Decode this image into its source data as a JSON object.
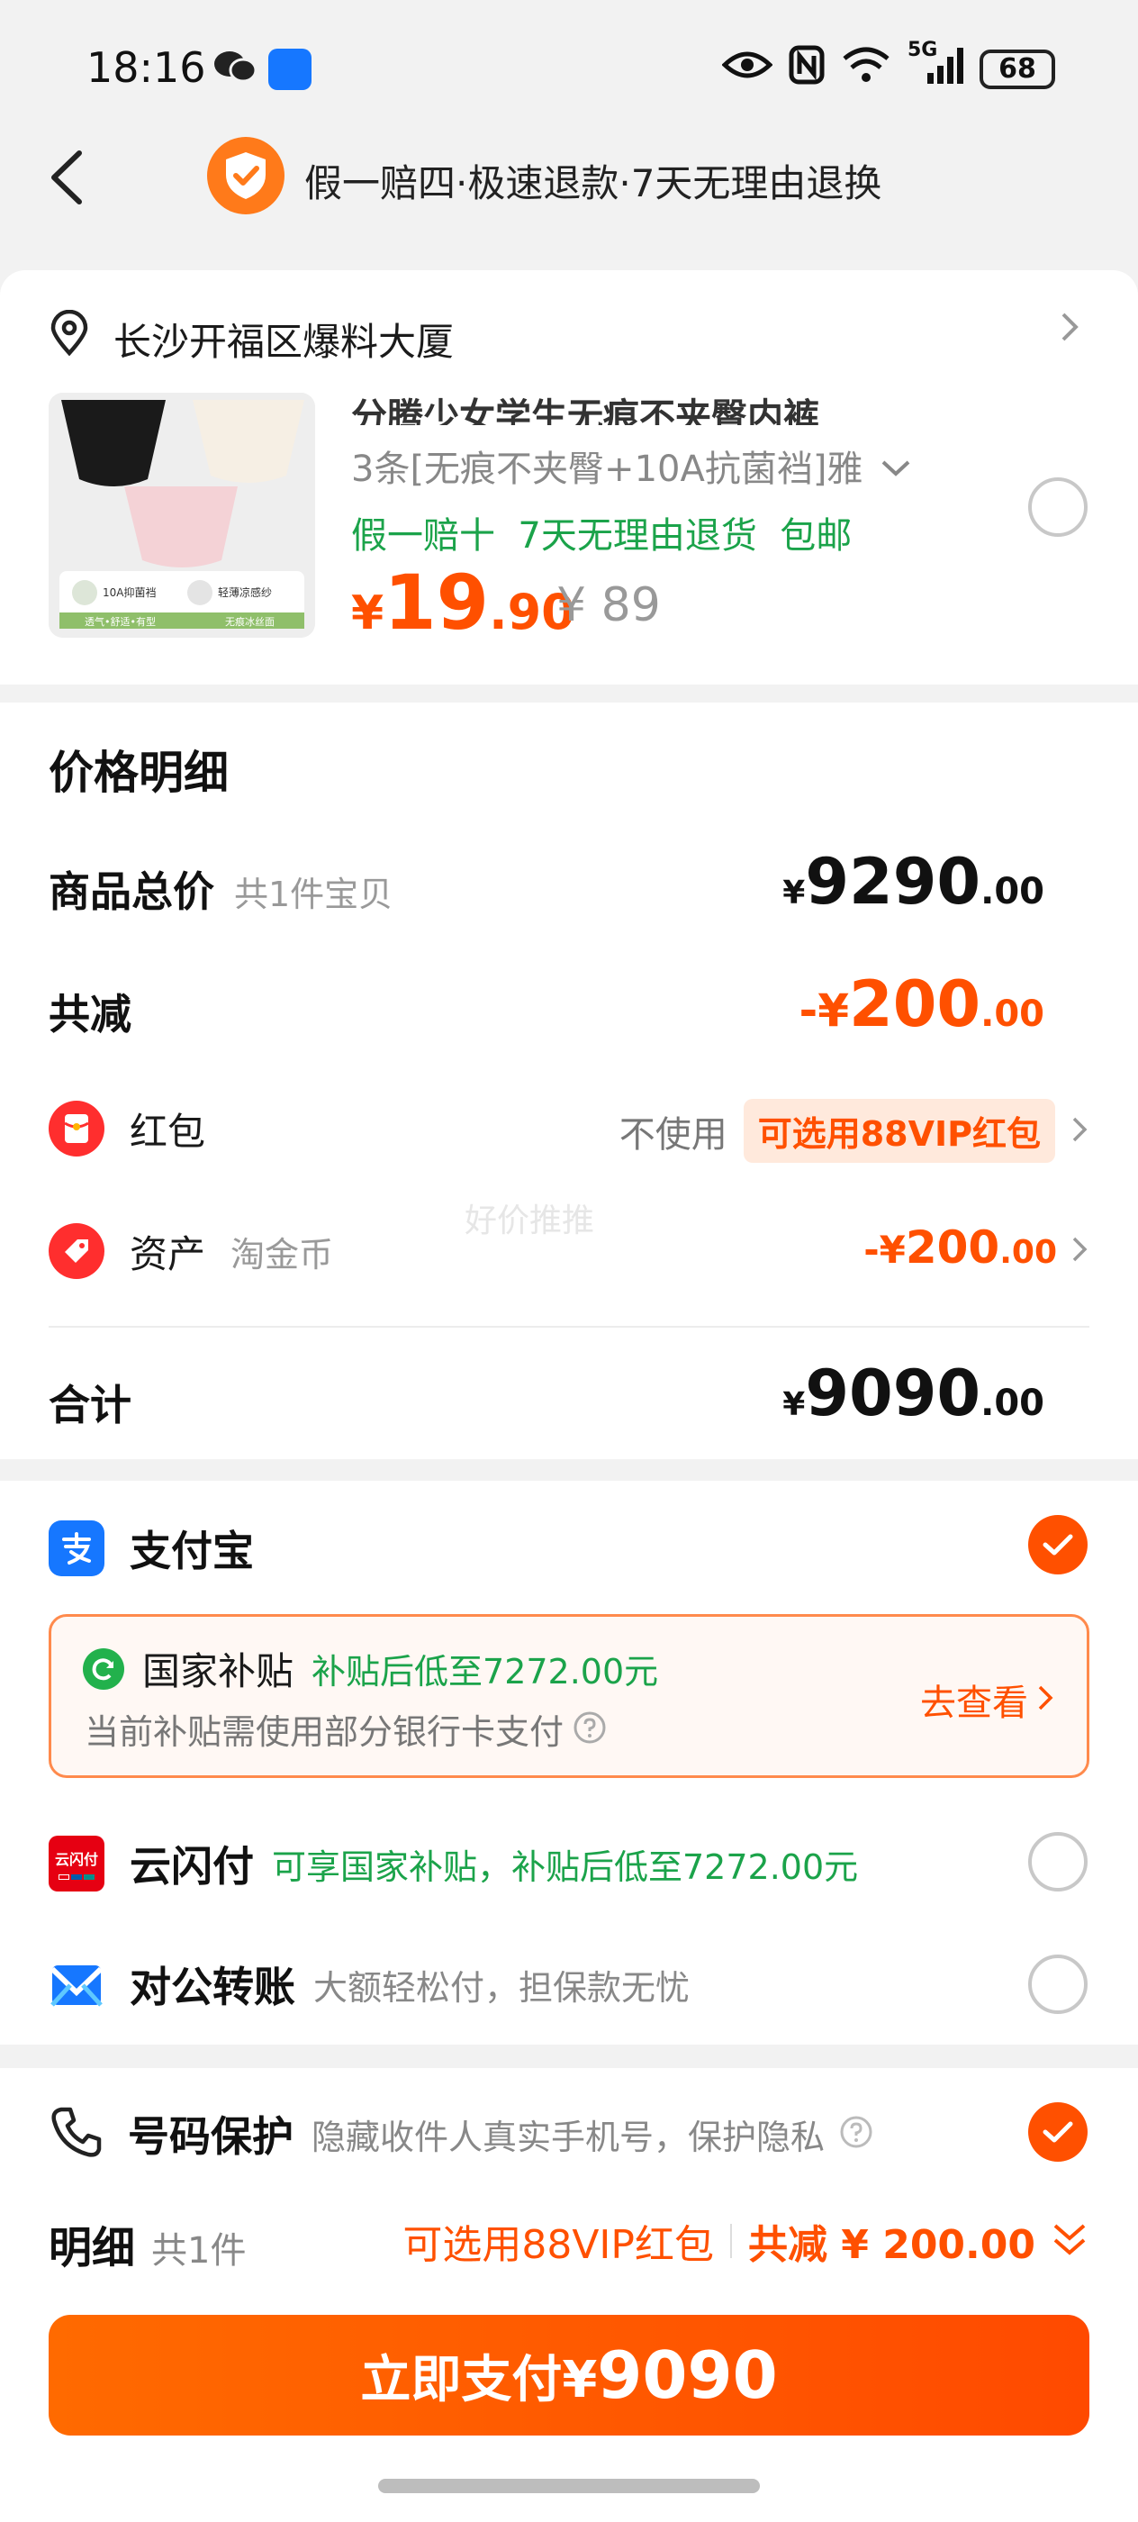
{
  "status_bar": {
    "time": "18:16",
    "battery": "68",
    "signal": "5G"
  },
  "header": {
    "title": "假一赔四·极速退款·7天无理由退换"
  },
  "address": {
    "text": "长沙开福区爆料大厦"
  },
  "product": {
    "title": "分腾少女学生无痕不夹臀内裤",
    "spec": "3条[无痕不夹臀+10A抗菌裆]雅",
    "tags": "假一赔十  7天无理由退货  包邮",
    "price_symbol": "¥",
    "price_int": "19",
    "price_dec": ".90",
    "original_price": "¥ 89",
    "image_labels": [
      "10A抑菌裆",
      "轻薄凉感纱",
      "透气•舒适•有型",
      "无痕冰丝面"
    ]
  },
  "price_detail": {
    "title": "价格明细",
    "goods_total_label": "商品总价",
    "goods_total_count": "共1件宝贝",
    "goods_total": {
      "cur": "¥",
      "int": "9290",
      "dec": ".00"
    },
    "discount_label": "共减",
    "discount": {
      "cur": "-¥",
      "int": "200",
      "dec": ".00"
    },
    "redpacket_label": "红包",
    "redpacket_status": "不使用",
    "redpacket_tag": "可选用88VIP红包",
    "assets_label": "资产",
    "assets_sub": "淘金币",
    "assets_amount": {
      "cur": "-¥",
      "int": "200",
      "dec": ".00"
    },
    "total_label": "合计",
    "total": {
      "cur": "¥",
      "int": "9090",
      "dec": ".00"
    },
    "watermark": "好价推推"
  },
  "payment": {
    "alipay_label": "支付宝",
    "subsidy_title": "国家补贴",
    "subsidy_price": "补贴后低至7272.00元",
    "subsidy_note": "当前补贴需使用部分银行卡支付",
    "subsidy_link": "去查看",
    "unionpay_label": "云闪付",
    "unionpay_logo_text": "云闪付",
    "unionpay_note": "可享国家补贴，补贴后低至7272.00元",
    "corporate_label": "对公转账",
    "corporate_note": "大额轻松付，担保款无忧"
  },
  "bottom": {
    "privacy_label": "号码保护",
    "privacy_note": "隐藏收件人真实手机号，保护隐私",
    "detail_label": "明细",
    "detail_count": "共1件",
    "vip_hint": "可选用88VIP红包",
    "total_discount": "共减 ¥ 200.00",
    "pay_prefix": "立即支付¥",
    "pay_amount": "9090"
  },
  "colors": {
    "accent": "#ff5000",
    "green": "#1ba34a",
    "alipay": "#1677ff"
  }
}
